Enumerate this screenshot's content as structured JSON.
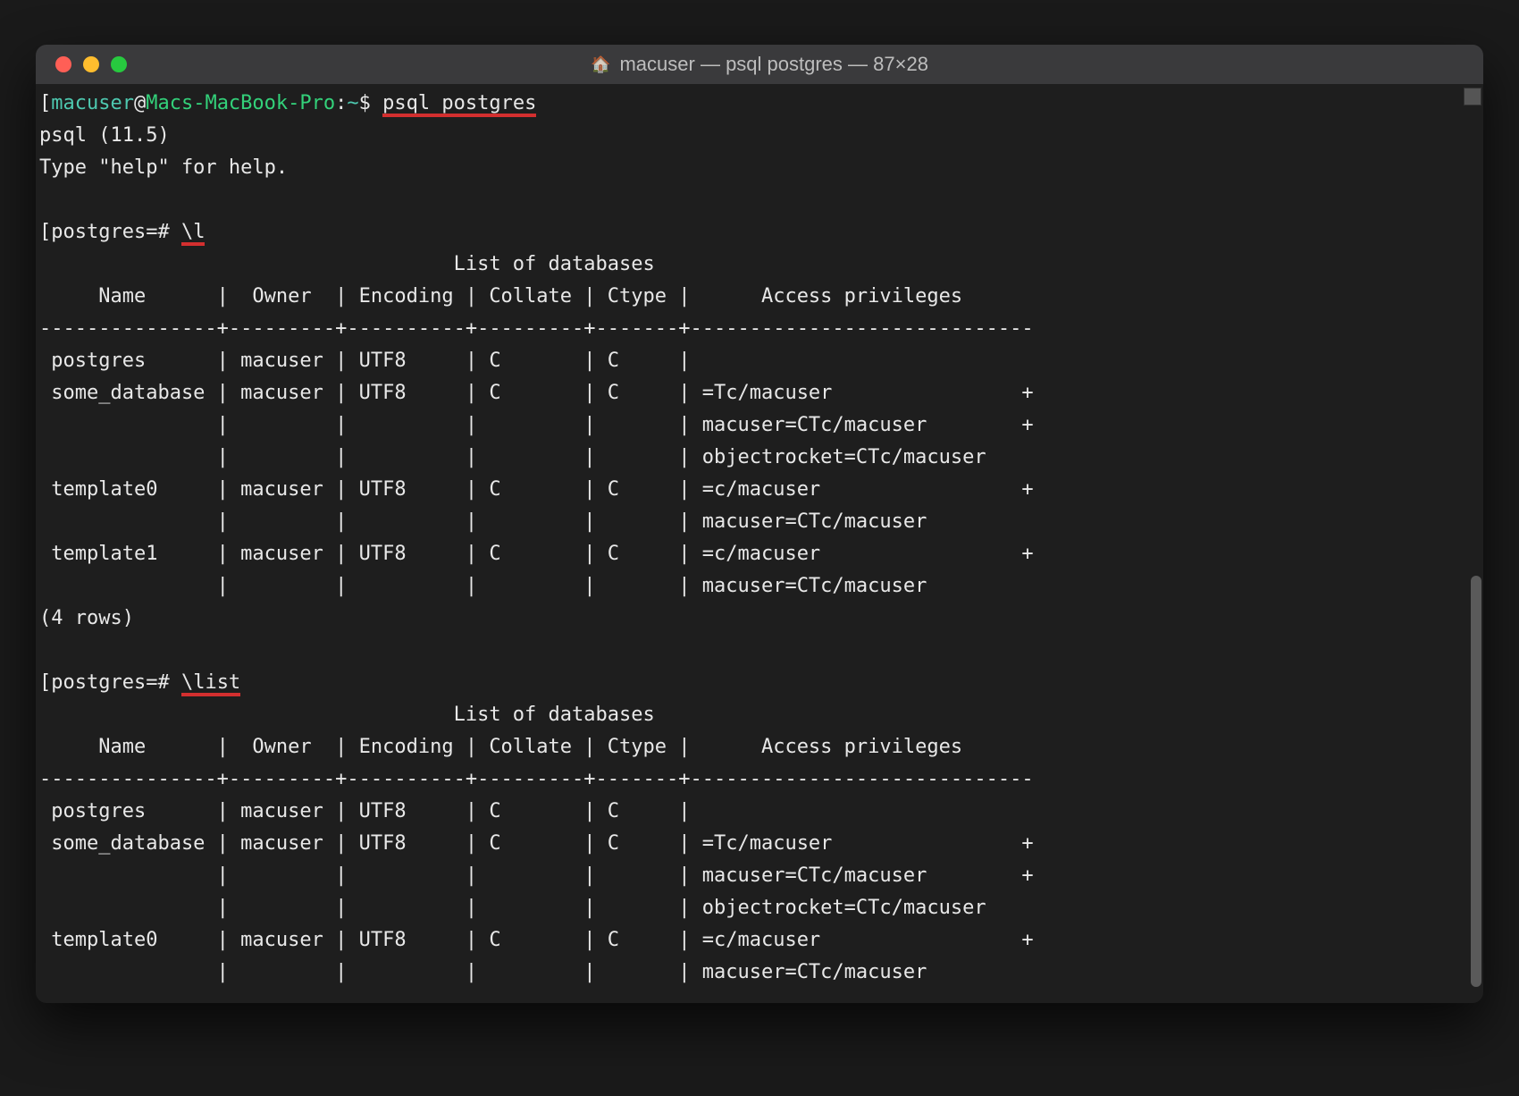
{
  "window": {
    "title": "macuser — psql postgres — 87×28"
  },
  "prompt": {
    "user": "macuser",
    "at": "@",
    "host": "Macs-MacBook-Pro",
    "sep": ":",
    "path": "~",
    "dollar": "$",
    "command": "psql postgres"
  },
  "psql": {
    "banner1": "psql (11.5)",
    "banner2": "Type \"help\" for help."
  },
  "prompt2": {
    "text": "postgres=# ",
    "cmd": "\\l"
  },
  "prompt3": {
    "text": "postgres=# ",
    "cmd": "\\list"
  },
  "table": {
    "title": "                                   List of databases",
    "header": "     Name      |  Owner  | Encoding | Collate | Ctype |      Access privileges      ",
    "divider": "---------------+---------+----------+---------+-------+-----------------------------",
    "rows1": [
      " postgres      | macuser | UTF8     | C       | C     | ",
      " some_database | macuser | UTF8     | C       | C     | =Tc/macuser                +",
      "               |         |          |         |       | macuser=CTc/macuser        +",
      "               |         |          |         |       | objectrocket=CTc/macuser",
      " template0     | macuser | UTF8     | C       | C     | =c/macuser                 +",
      "               |         |          |         |       | macuser=CTc/macuser",
      " template1     | macuser | UTF8     | C       | C     | =c/macuser                 +",
      "               |         |          |         |       | macuser=CTc/macuser"
    ],
    "footer": "(4 rows)",
    "rows2": [
      " postgres      | macuser | UTF8     | C       | C     | ",
      " some_database | macuser | UTF8     | C       | C     | =Tc/macuser                +",
      "               |         |          |         |       | macuser=CTc/macuser        +",
      "               |         |          |         |       | objectrocket=CTc/macuser",
      " template0     | macuser | UTF8     | C       | C     | =c/macuser                 +",
      "               |         |          |         |       | macuser=CTc/macuser"
    ]
  }
}
